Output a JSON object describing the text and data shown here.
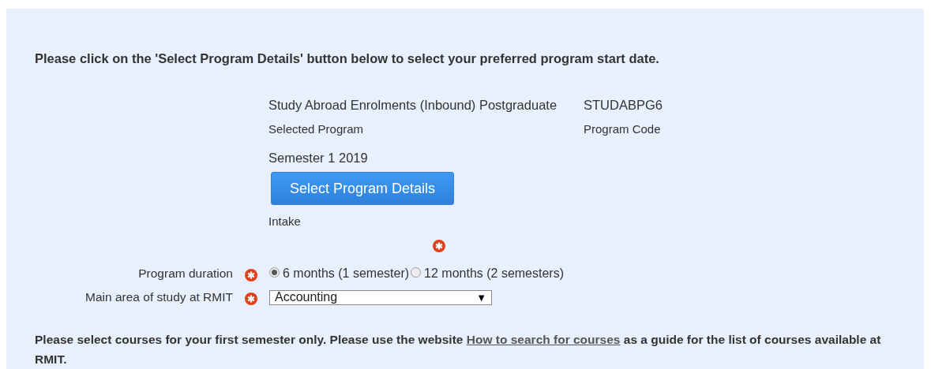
{
  "instruction": "Please click on the 'Select Program Details' button below to select your preferred program start date.",
  "program": {
    "name": "Study Abroad Enrolments (Inbound) Postgraduate",
    "name_label": "Selected Program",
    "code": "STUDABPG6",
    "code_label": "Program Code",
    "intake_value": "Semester 1 2019",
    "button": "Select Program Details",
    "intake_label": "Intake",
    "intake_required": true
  },
  "fields": [
    {
      "kind": "radio",
      "label": "Program duration",
      "required": true,
      "options": [
        {
          "label": "6 months (1 semester)",
          "selected": true
        },
        {
          "label": "12 months (2 semesters)",
          "selected": false
        }
      ]
    },
    {
      "kind": "select",
      "label": "Main area of study at RMIT",
      "required": true,
      "value": "Accounting",
      "arrow": "▼"
    }
  ],
  "note": {
    "before": "Please select courses for your first semester only. Please use the website ",
    "link": "How to search for courses",
    "after": " as a guide for the list of courses available at RMIT."
  }
}
